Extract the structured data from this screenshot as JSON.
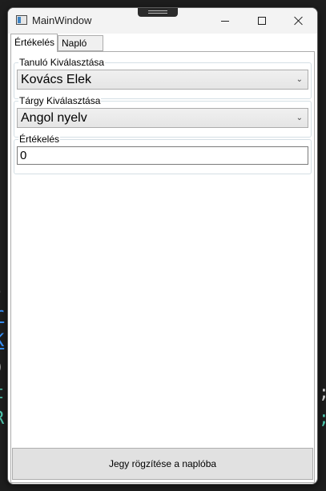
{
  "window": {
    "title": "MainWindow",
    "controls": {
      "minimize_icon": "minimize-icon",
      "maximize_icon": "maximize-icon",
      "close_icon": "close-icon"
    }
  },
  "tabs": [
    {
      "label": "Értékelés",
      "active": true
    },
    {
      "label": "Napló",
      "active": false
    }
  ],
  "form": {
    "student": {
      "label": "Tanuló Kiválasztása",
      "value": "Kovács Elek"
    },
    "subject": {
      "label": "Tárgy Kiválasztása",
      "value": "Angol nyelv"
    },
    "grade": {
      "label": "Értékelés",
      "value": "0"
    },
    "submit_label": "Jegy rögzítése a naplóba"
  },
  "background_fragments": {
    "left": [
      ";",
      "r",
      "K",
      ")",
      "t",
      "R"
    ],
    "right": [
      ";",
      "s;"
    ]
  }
}
